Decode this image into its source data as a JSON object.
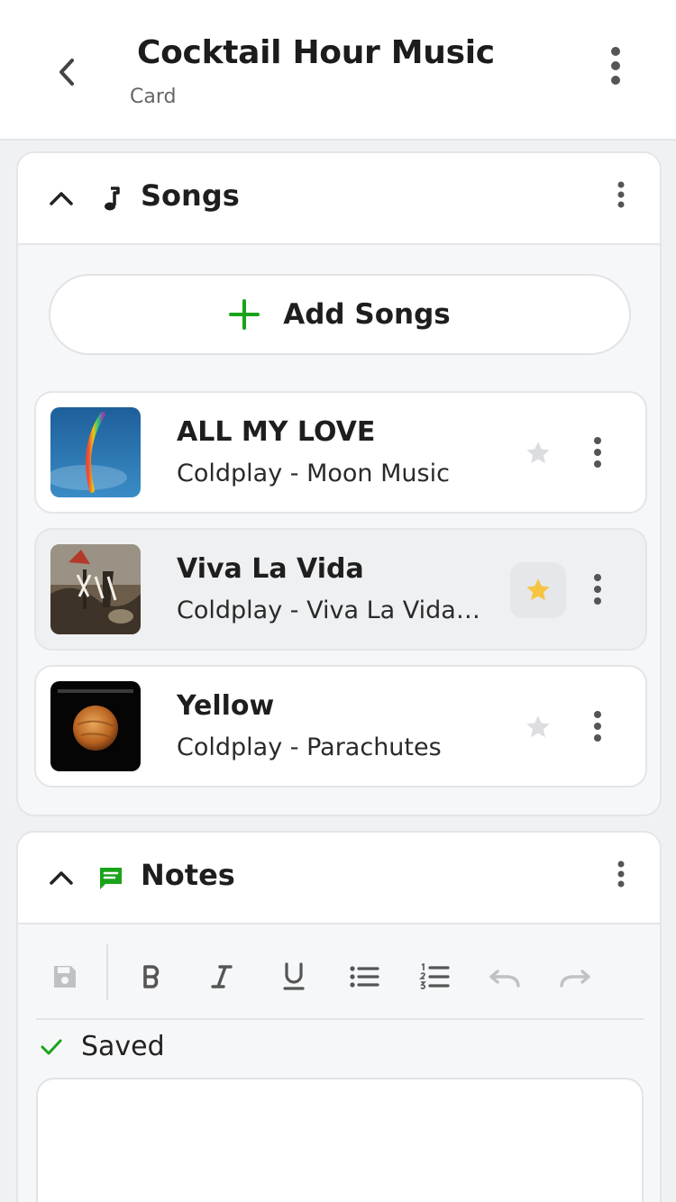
{
  "header": {
    "title": "Cocktail Hour Music",
    "subtitle": "Card"
  },
  "songs_section": {
    "title": "Songs",
    "add_label": "Add Songs",
    "songs": [
      {
        "title": "ALL MY LOVE",
        "subtitle": "Coldplay - Moon Music",
        "favorite": false,
        "cover": "moon-music-cover"
      },
      {
        "title": "Viva La Vida",
        "subtitle": "Coldplay - Viva La Vida or Death and All His Friends",
        "favorite": true,
        "cover": "viva-la-vida-cover"
      },
      {
        "title": "Yellow",
        "subtitle": "Coldplay - Parachutes",
        "favorite": false,
        "cover": "parachutes-cover"
      }
    ]
  },
  "notes_section": {
    "title": "Notes",
    "status": "Saved",
    "content": ""
  },
  "colors": {
    "accent_green": "#1aa31a",
    "star_active": "#f5c542",
    "star_inactive": "#dcdde0"
  },
  "icons": {
    "back": "chevron-left-icon",
    "collapse": "chevron-up-icon",
    "songs": "music-note-icon",
    "notes": "chat-note-icon",
    "menu": "more-vertical-icon",
    "favorite": "star-icon"
  }
}
